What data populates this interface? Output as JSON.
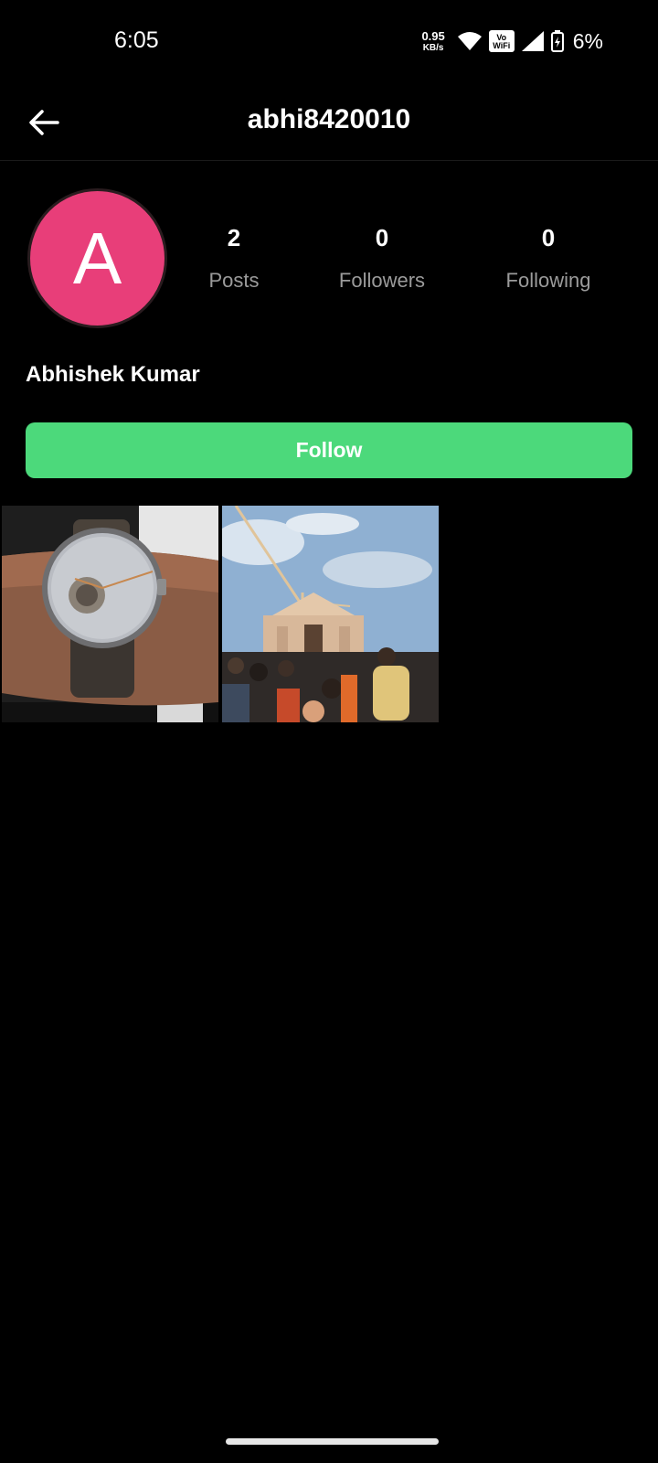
{
  "status_bar": {
    "time": "6:05",
    "net_speed_value": "0.95",
    "net_speed_unit": "KB/s",
    "vowifi_top": "Vo",
    "vowifi_bottom": "WiFi",
    "battery": "6%",
    "icons": [
      "wifi-icon",
      "signal-icon",
      "battery-icon"
    ]
  },
  "app_bar": {
    "title": "abhi8420010",
    "back_icon": "arrow-left-icon"
  },
  "profile": {
    "avatar_letter": "A",
    "avatar_color": "#e83e79",
    "display_name": "Abhishek Kumar",
    "stats": {
      "posts_count": "2",
      "posts_label": "Posts",
      "followers_count": "0",
      "followers_label": "Followers",
      "following_count": "0",
      "following_label": "Following"
    }
  },
  "follow_button": {
    "label": "Follow",
    "color": "#4cd97b"
  }
}
